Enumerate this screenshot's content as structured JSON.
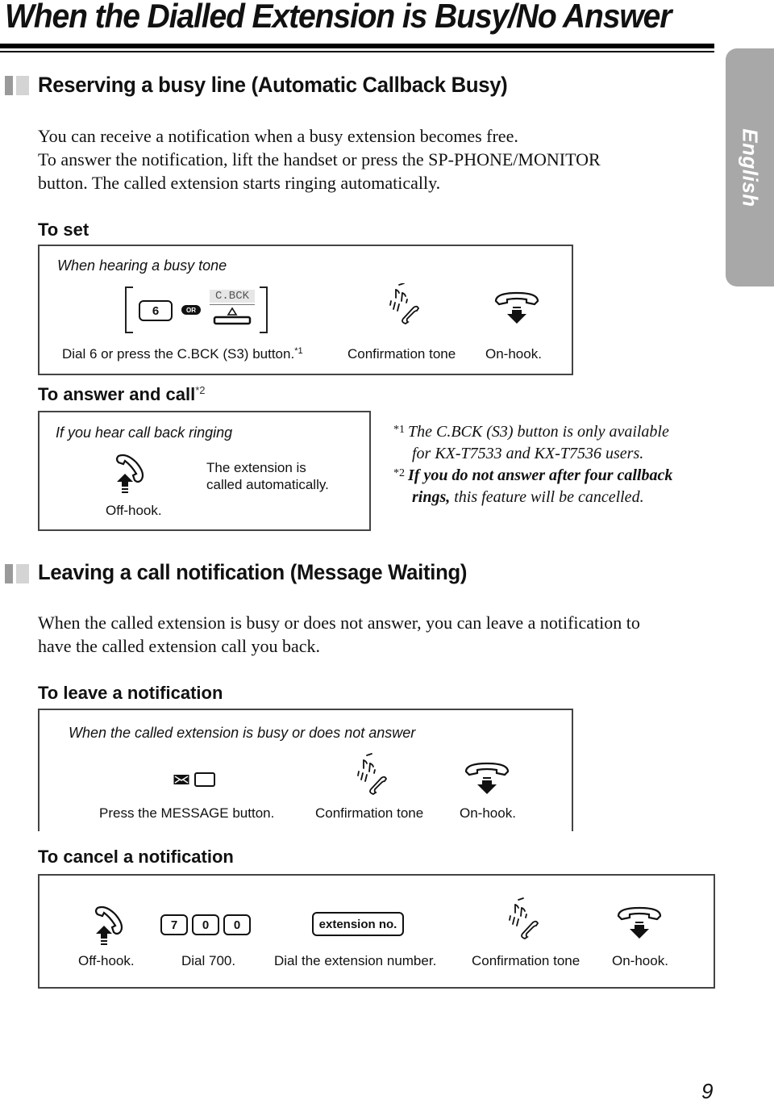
{
  "page": {
    "title": "When the Dialled Extension is Busy/No Answer",
    "language_tab": "English",
    "page_number": "9"
  },
  "section1": {
    "title": "Reserving a busy line (Automatic Callback Busy)",
    "intro_lines": [
      "You can receive a notification when a busy extension becomes free.",
      "To answer the notification, lift the handset or press the SP-PHONE/MONITOR",
      "button. The called extension starts ringing automatically."
    ],
    "to_set": {
      "heading": "To set",
      "caption": "When hearing a busy tone",
      "key_6": "6",
      "or_badge": "OR",
      "cbck_key_label": "C.BCK",
      "steps": [
        {
          "label": "Dial 6 or press the C.BCK (S3) button.",
          "footnote_ref": "*1"
        },
        {
          "label": "Confirmation tone"
        },
        {
          "label": "On-hook."
        }
      ]
    },
    "to_answer": {
      "heading": "To answer and call",
      "heading_ref": "*2",
      "caption": "If you hear call back ringing",
      "offhook_label": "Off-hook.",
      "note_line1": "The extension is",
      "note_line2": "called automatically."
    },
    "footnotes": [
      {
        "marker": "*1",
        "line1": "The C.BCK (S3) button is only available",
        "line2": "for KX-T7533 and KX-T7536 users."
      },
      {
        "marker": "*2",
        "line1_bold": "If you do not answer after four callback",
        "line2_bold": "rings,",
        "line2_rest": " this feature will be cancelled."
      }
    ]
  },
  "section2": {
    "title": "Leaving a call notification (Message Waiting)",
    "intro_lines": [
      "When the called extension is busy or does not answer, you can leave a notification to",
      "have the called extension call you back."
    ],
    "to_leave": {
      "heading": "To leave a notification",
      "caption": "When the called extension is busy or does not answer",
      "steps": [
        {
          "label": "Press the MESSAGE button."
        },
        {
          "label": "Confirmation tone"
        },
        {
          "label": "On-hook."
        }
      ]
    },
    "to_cancel": {
      "heading": "To cancel a notification",
      "keys": [
        "7",
        "0",
        "0"
      ],
      "extension_key": "extension no.",
      "steps": [
        {
          "label": "Off-hook."
        },
        {
          "label": "Dial 700."
        },
        {
          "label": "Dial the extension number."
        },
        {
          "label": "Confirmation tone"
        },
        {
          "label": "On-hook."
        }
      ]
    }
  },
  "icons": {
    "offhook": "handset-lift-icon",
    "onhook": "handset-down-icon",
    "confirmation": "confirmation-tone-icon",
    "message": "message-envelope-icon"
  },
  "colors": {
    "text": "#111111",
    "tab_gray": "#a8a8a8",
    "marker_dark": "#9a9a9a",
    "marker_light": "#d4d4d4",
    "box_border": "#444444"
  }
}
